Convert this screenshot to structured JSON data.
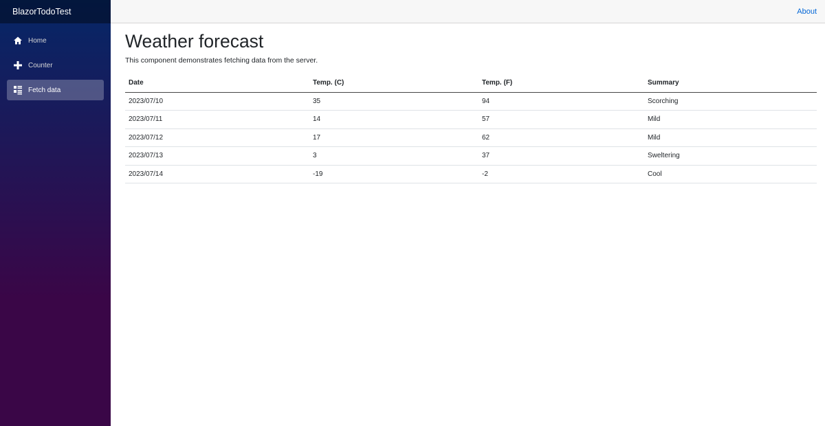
{
  "app": {
    "brand": "BlazorTodoTest"
  },
  "sidebar": {
    "items": [
      {
        "label": "Home",
        "icon": "home-icon",
        "active": false
      },
      {
        "label": "Counter",
        "icon": "plus-icon",
        "active": false
      },
      {
        "label": "Fetch data",
        "icon": "list-rich-icon",
        "active": true
      }
    ]
  },
  "topbar": {
    "about_label": "About"
  },
  "main": {
    "title": "Weather forecast",
    "intro": "This component demonstrates fetching data from the server.",
    "table": {
      "headers": [
        "Date",
        "Temp. (C)",
        "Temp. (F)",
        "Summary"
      ],
      "rows": [
        [
          "2023/07/10",
          "35",
          "94",
          "Scorching"
        ],
        [
          "2023/07/11",
          "14",
          "57",
          "Mild"
        ],
        [
          "2023/07/12",
          "17",
          "62",
          "Mild"
        ],
        [
          "2023/07/13",
          "3",
          "37",
          "Sweltering"
        ],
        [
          "2023/07/14",
          "-19",
          "-2",
          "Cool"
        ]
      ]
    }
  },
  "colors": {
    "sidebar_gradient_start": "#052767",
    "sidebar_gradient_end": "#3a0647",
    "link": "#0366d6"
  }
}
